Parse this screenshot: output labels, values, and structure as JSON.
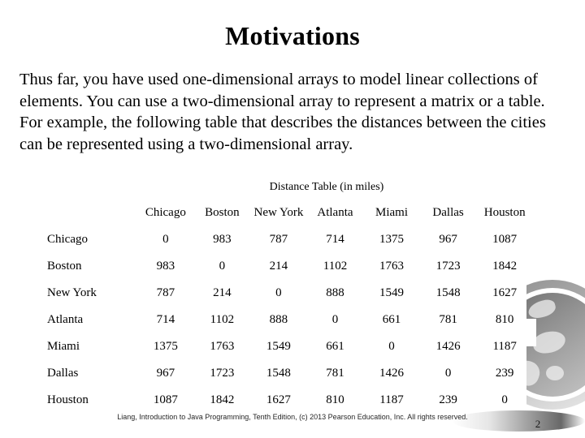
{
  "slide": {
    "title": "Motivations",
    "body_text": "Thus far, you have used one-dimensional arrays to model linear collections of elements. You can use a two-dimensional array to represent a matrix or a table. For example, the following table that describes the distances between the cities can be represented using a two-dimensional array.",
    "page_number": "2",
    "footer": "Liang, Introduction to Java Programming, Tenth Edition, (c) 2013 Pearson Education, Inc. All rights reserved.",
    "decoration": {
      "globe_icon": "globe-icon",
      "swoosh": "footer-swoosh"
    }
  },
  "chart_data": {
    "type": "table",
    "title": "Distance Table (in miles)",
    "corner_label": "",
    "categories": [
      "Chicago",
      "Boston",
      "New York",
      "Atlanta",
      "Miami",
      "Dallas",
      "Houston"
    ],
    "row_labels": [
      "Chicago",
      "Boston",
      "New York",
      "Atlanta",
      "Miami",
      "Dallas",
      "Houston"
    ],
    "column_headers": [
      "Chicago",
      "Boston",
      "New York",
      "Atlanta",
      "Miami",
      "Dallas",
      "Houston"
    ],
    "rows": [
      {
        "label": "Chicago",
        "values": [
          "0",
          "983",
          "787",
          "714",
          "1375",
          "967",
          "1087"
        ]
      },
      {
        "label": "Boston",
        "values": [
          "983",
          "0",
          "214",
          "1102",
          "1763",
          "1723",
          "1842"
        ]
      },
      {
        "label": "New York",
        "values": [
          "787",
          "214",
          "0",
          "888",
          "1549",
          "1548",
          "1627"
        ]
      },
      {
        "label": "Atlanta",
        "values": [
          "714",
          "1102",
          "888",
          "0",
          "661",
          "781",
          "810"
        ]
      },
      {
        "label": "Miami",
        "values": [
          "1375",
          "1763",
          "1549",
          "661",
          "0",
          "1426",
          "1187"
        ]
      },
      {
        "label": "Dallas",
        "values": [
          "967",
          "1723",
          "1548",
          "781",
          "1426",
          "0",
          "239"
        ]
      },
      {
        "label": "Houston",
        "values": [
          "1087",
          "1842",
          "1627",
          "810",
          "1187",
          "239",
          "0"
        ]
      }
    ],
    "units": "miles",
    "grid": false,
    "legend": "none"
  },
  "colors": {
    "background": "#ffffff",
    "text": "#000000",
    "footer_text": "#262626",
    "decoration_gray": "#8a8a8a"
  }
}
